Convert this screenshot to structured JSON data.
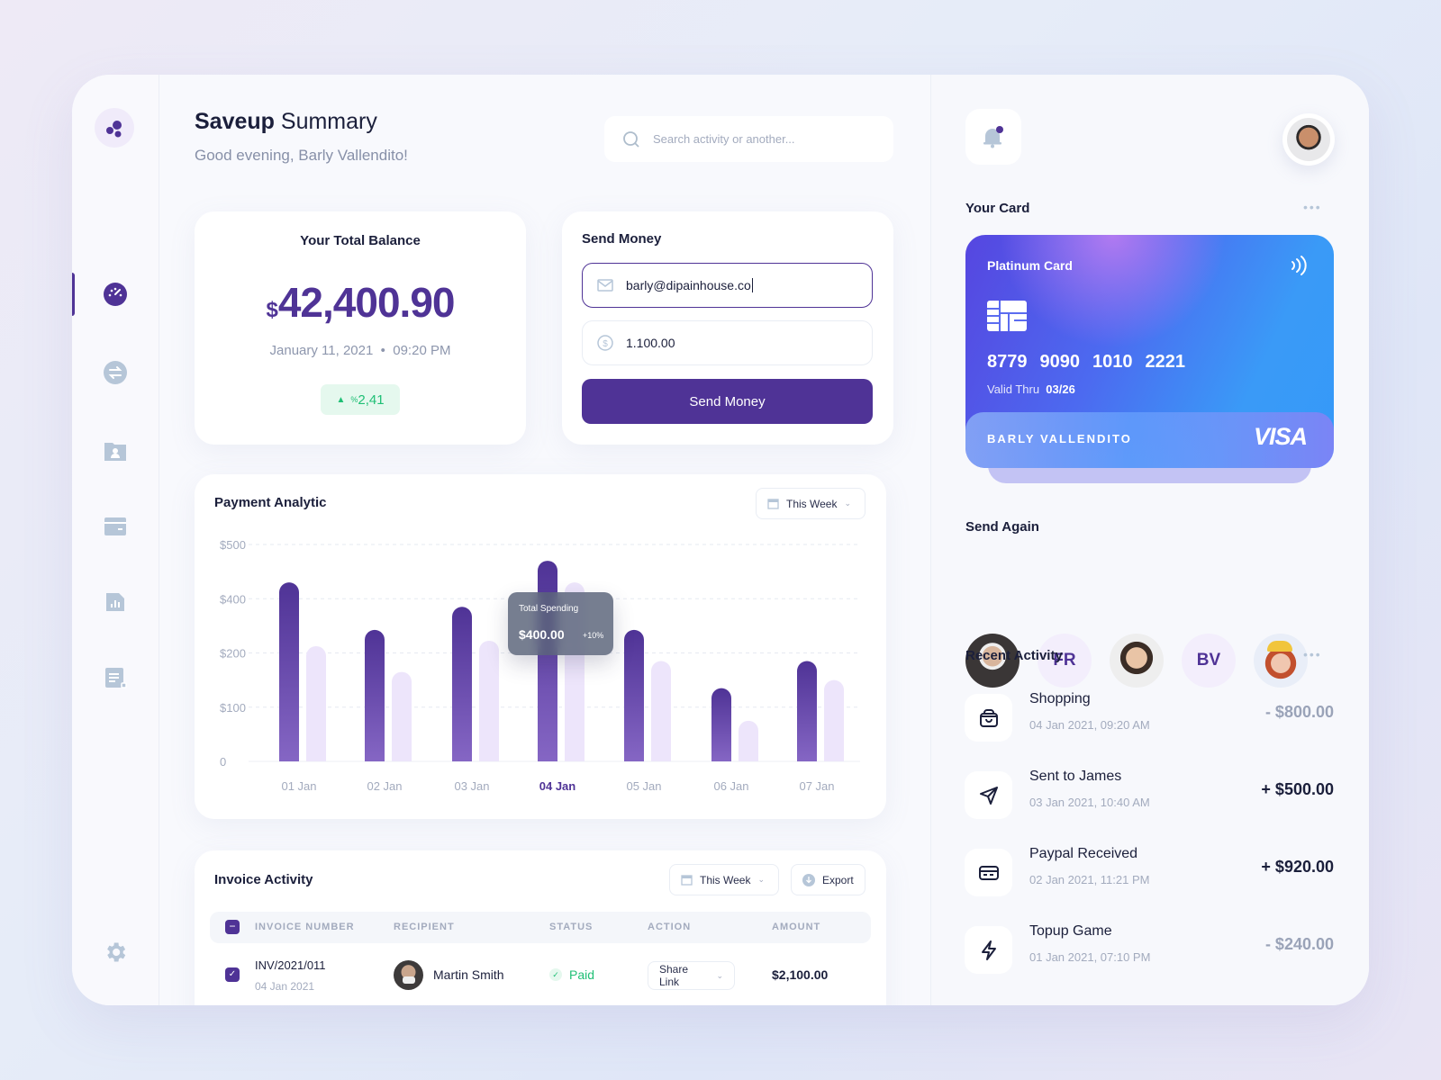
{
  "header": {
    "title_bold": "Saveup",
    "title_rest": "Summary",
    "greeting": "Good evening, Barly Vallendito!",
    "search_placeholder": "Search activity or another..."
  },
  "sidebar": {
    "items": [
      {
        "icon": "dashboard-icon",
        "active": true
      },
      {
        "icon": "transfer-icon"
      },
      {
        "icon": "contacts-folder-icon"
      },
      {
        "icon": "wallet-icon"
      },
      {
        "icon": "report-icon"
      },
      {
        "icon": "invoice-icon"
      }
    ],
    "settings_icon": "gear-icon"
  },
  "balance": {
    "title": "Your Total Balance",
    "currency": "$",
    "amount": "42,400.90",
    "date": "January 11, 2021",
    "time": "09:20 PM",
    "change": "2,41",
    "change_prefix": "%"
  },
  "send_money": {
    "title": "Send Money",
    "email_value": "barly@dipainhouse.co",
    "amount_value": "1.100.00",
    "button": "Send Money"
  },
  "analytic": {
    "title": "Payment Analytic",
    "filter": "This Week",
    "tooltip": {
      "label": "Total Spending",
      "value": "$400.00",
      "change": "+10%"
    }
  },
  "chart_data": {
    "type": "bar",
    "categories": [
      "01 Jan",
      "02 Jan",
      "03 Jan",
      "04 Jan",
      "05 Jan",
      "06 Jan",
      "07 Jan"
    ],
    "highlighted": "04 Jan",
    "series": [
      {
        "values": [
          430,
          285,
          370,
          470,
          285,
          135,
          185
        ],
        "color": "#4f3396"
      },
      {
        "values": [
          225,
          165,
          245,
          430,
          185,
          75,
          150
        ],
        "color": "#ede5fb"
      }
    ],
    "y_ticks": [
      0,
      100,
      200,
      400,
      500
    ],
    "y_tick_labels": [
      "0",
      "$100",
      "$200",
      "$400",
      "$500"
    ],
    "ylim": [
      0,
      500
    ],
    "grid": true
  },
  "invoice": {
    "title": "Invoice Activity",
    "filter": "This Week",
    "export": "Export",
    "columns": [
      "INVOICE NUMBER",
      "RECIPIENT",
      "STATUS",
      "ACTION",
      "AMOUNT"
    ],
    "rows": [
      {
        "number": "INV/2021/011",
        "date": "04 Jan 2021",
        "recipient": "Martin Smith",
        "status": "Paid",
        "action": "Share Link",
        "amount": "$2,100.00"
      }
    ]
  },
  "right": {
    "your_card_title": "Your Card",
    "card": {
      "type": "Platinum Card",
      "number": [
        "8779",
        "9090",
        "1010",
        "2221"
      ],
      "valid_label": "Valid Thru",
      "valid": "03/26",
      "holder": "BARLY VALLENDITO",
      "brand": "VISA"
    },
    "send_again_title": "Send Again",
    "send_again": [
      {
        "type": "photo"
      },
      {
        "initials": "FR"
      },
      {
        "type": "photo"
      },
      {
        "initials": "BV"
      },
      {
        "type": "photo"
      }
    ],
    "recent_title": "Recent Activity",
    "activities": [
      {
        "title": "Shopping",
        "date": "04 Jan  2021, 09:20 AM",
        "amount": "- $800.00",
        "icon": "shopping-bag-icon",
        "positive": false
      },
      {
        "title": "Sent to James",
        "date": "03 Jan  2021, 10:40 AM",
        "amount": "+ $500.00",
        "icon": "send-icon",
        "positive": true
      },
      {
        "title": "Paypal Received",
        "date": "02 Jan  2021, 11:21 PM",
        "amount": "+ $920.00",
        "icon": "card-icon",
        "positive": true
      },
      {
        "title": "Topup Game",
        "date": "01 Jan  2021, 07:10 PM",
        "amount": "- $240.00",
        "icon": "lightning-icon",
        "positive": false
      }
    ]
  },
  "colors": {
    "primary": "#4f3396",
    "light_bar": "#ede5fb",
    "positive": "#1fbf75",
    "muted": "#9aa3b8"
  }
}
